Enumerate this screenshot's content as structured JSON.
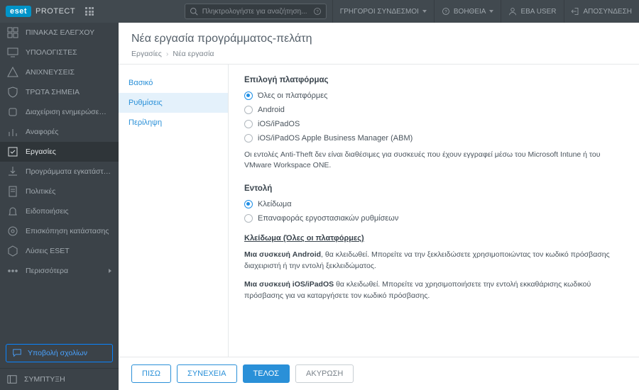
{
  "brand": {
    "logo": "eset",
    "product": "PROTECT"
  },
  "search": {
    "placeholder": "Πληκτρολογήστε για αναζήτηση..."
  },
  "topnav": {
    "quicklinks": "ΓΡΗΓΟΡΟΙ ΣΥΝΔΕΣΜΟΙ",
    "help": "ΒΟΗΘΕΙΑ",
    "user": "EBA USER",
    "logout": "ΑΠΟΣΥΝΔΕΣΗ"
  },
  "sidebar": {
    "items": [
      {
        "label": "ΠΙΝΑΚΑΣ ΕΛΕΓΧΟΥ"
      },
      {
        "label": "ΥΠΟΛΟΓΙΣΤΕΣ"
      },
      {
        "label": "ΑΝΙΧΝΕΥΣΕΙΣ"
      },
      {
        "label": "ΤΡΩΤΑ ΣΗΜΕΙΑ"
      },
      {
        "label": "Διαχείριση ενημερώσεων κ..."
      },
      {
        "label": "Αναφορές"
      },
      {
        "label": "Εργασίες"
      },
      {
        "label": "Προγράμματα εγκατάστασης"
      },
      {
        "label": "Πολιτικές"
      },
      {
        "label": "Ειδοποιήσεις"
      },
      {
        "label": "Επισκόπηση κατάστασης"
      },
      {
        "label": "Λύσεις ESET"
      },
      {
        "label": "Περισσότερα"
      }
    ],
    "feedback": "Υποβολή σχολίων",
    "collapse": "ΣΥΜΠΤΥΞΗ"
  },
  "page": {
    "title": "Νέα εργασία προγράμματος-πελάτη",
    "breadcrumb": {
      "root": "Εργασίες",
      "current": "Νέα εργασία"
    }
  },
  "wizard": {
    "steps": [
      {
        "label": "Βασικό"
      },
      {
        "label": "Ρυθμίσεις"
      },
      {
        "label": "Περίληψη"
      }
    ]
  },
  "form": {
    "platform": {
      "title": "Επιλογή πλατφόρμας",
      "options": [
        {
          "label": "Όλες οι πλατφόρμες",
          "checked": true
        },
        {
          "label": "Android",
          "checked": false
        },
        {
          "label": "iOS/iPadOS",
          "checked": false
        },
        {
          "label": "iOS/iPadOS Apple Business Manager (ABM)",
          "checked": false
        }
      ],
      "note": "Οι εντολές Anti-Theft δεν είναι διαθέσιμες για συσκευές που έχουν εγγραφεί μέσω του Microsoft Intune ή του VMware Workspace ONE."
    },
    "command": {
      "title": "Εντολή",
      "options": [
        {
          "label": "Κλείδωμα",
          "checked": true
        },
        {
          "label": "Επαναφοράς εργοστασιακών ρυθμίσεων",
          "checked": false
        }
      ]
    },
    "detail": {
      "heading": "Κλείδωμα (Όλες οι πλατφόρμες)",
      "p1_bold": "Μια συσκευή Android",
      "p1_rest": ", θα κλειδωθεί. Μπορείτε να την ξεκλειδώσετε χρησιμοποιώντας τον κωδικό πρόσβασης διαχειριστή ή την εντολή ξεκλειδώματος.",
      "p2_bold": "Μια συσκευή iOS/iPadOS",
      "p2_rest": " θα κλειδωθεί. Μπορείτε να χρησιμοποιήσετε την εντολή εκκαθάρισης κωδικού πρόσβασης για να καταργήσετε τον κωδικό πρόσβασης."
    }
  },
  "footer": {
    "back": "ΠΙΣΩ",
    "continue": "ΣΥΝΕΧΕΙΑ",
    "finish": "ΤΕΛΟΣ",
    "cancel": "ΑΚΥΡΩΣΗ"
  }
}
